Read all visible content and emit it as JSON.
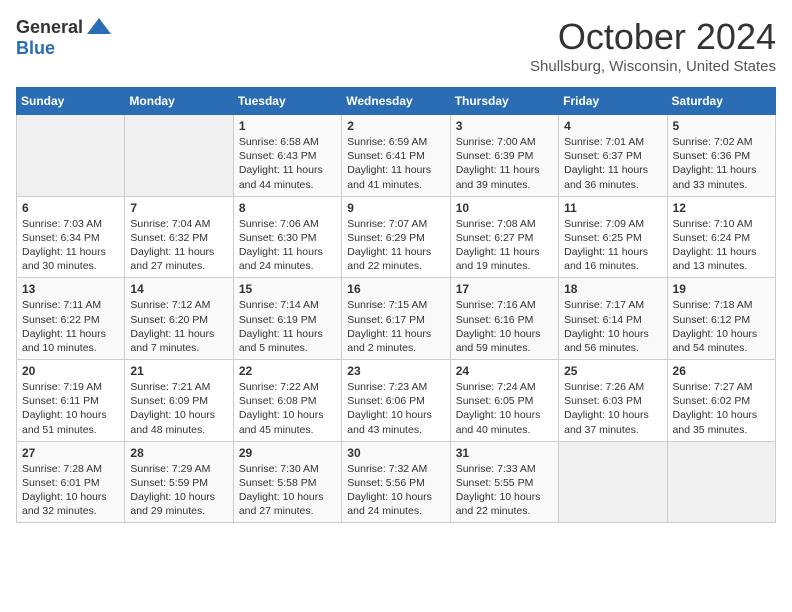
{
  "logo": {
    "general": "General",
    "blue": "Blue"
  },
  "title": {
    "month": "October 2024",
    "location": "Shullsburg, Wisconsin, United States"
  },
  "headers": [
    "Sunday",
    "Monday",
    "Tuesday",
    "Wednesday",
    "Thursday",
    "Friday",
    "Saturday"
  ],
  "weeks": [
    [
      null,
      null,
      {
        "day": "1",
        "sunrise": "Sunrise: 6:58 AM",
        "sunset": "Sunset: 6:43 PM",
        "daylight": "Daylight: 11 hours and 44 minutes."
      },
      {
        "day": "2",
        "sunrise": "Sunrise: 6:59 AM",
        "sunset": "Sunset: 6:41 PM",
        "daylight": "Daylight: 11 hours and 41 minutes."
      },
      {
        "day": "3",
        "sunrise": "Sunrise: 7:00 AM",
        "sunset": "Sunset: 6:39 PM",
        "daylight": "Daylight: 11 hours and 39 minutes."
      },
      {
        "day": "4",
        "sunrise": "Sunrise: 7:01 AM",
        "sunset": "Sunset: 6:37 PM",
        "daylight": "Daylight: 11 hours and 36 minutes."
      },
      {
        "day": "5",
        "sunrise": "Sunrise: 7:02 AM",
        "sunset": "Sunset: 6:36 PM",
        "daylight": "Daylight: 11 hours and 33 minutes."
      }
    ],
    [
      {
        "day": "6",
        "sunrise": "Sunrise: 7:03 AM",
        "sunset": "Sunset: 6:34 PM",
        "daylight": "Daylight: 11 hours and 30 minutes."
      },
      {
        "day": "7",
        "sunrise": "Sunrise: 7:04 AM",
        "sunset": "Sunset: 6:32 PM",
        "daylight": "Daylight: 11 hours and 27 minutes."
      },
      {
        "day": "8",
        "sunrise": "Sunrise: 7:06 AM",
        "sunset": "Sunset: 6:30 PM",
        "daylight": "Daylight: 11 hours and 24 minutes."
      },
      {
        "day": "9",
        "sunrise": "Sunrise: 7:07 AM",
        "sunset": "Sunset: 6:29 PM",
        "daylight": "Daylight: 11 hours and 22 minutes."
      },
      {
        "day": "10",
        "sunrise": "Sunrise: 7:08 AM",
        "sunset": "Sunset: 6:27 PM",
        "daylight": "Daylight: 11 hours and 19 minutes."
      },
      {
        "day": "11",
        "sunrise": "Sunrise: 7:09 AM",
        "sunset": "Sunset: 6:25 PM",
        "daylight": "Daylight: 11 hours and 16 minutes."
      },
      {
        "day": "12",
        "sunrise": "Sunrise: 7:10 AM",
        "sunset": "Sunset: 6:24 PM",
        "daylight": "Daylight: 11 hours and 13 minutes."
      }
    ],
    [
      {
        "day": "13",
        "sunrise": "Sunrise: 7:11 AM",
        "sunset": "Sunset: 6:22 PM",
        "daylight": "Daylight: 11 hours and 10 minutes."
      },
      {
        "day": "14",
        "sunrise": "Sunrise: 7:12 AM",
        "sunset": "Sunset: 6:20 PM",
        "daylight": "Daylight: 11 hours and 7 minutes."
      },
      {
        "day": "15",
        "sunrise": "Sunrise: 7:14 AM",
        "sunset": "Sunset: 6:19 PM",
        "daylight": "Daylight: 11 hours and 5 minutes."
      },
      {
        "day": "16",
        "sunrise": "Sunrise: 7:15 AM",
        "sunset": "Sunset: 6:17 PM",
        "daylight": "Daylight: 11 hours and 2 minutes."
      },
      {
        "day": "17",
        "sunrise": "Sunrise: 7:16 AM",
        "sunset": "Sunset: 6:16 PM",
        "daylight": "Daylight: 10 hours and 59 minutes."
      },
      {
        "day": "18",
        "sunrise": "Sunrise: 7:17 AM",
        "sunset": "Sunset: 6:14 PM",
        "daylight": "Daylight: 10 hours and 56 minutes."
      },
      {
        "day": "19",
        "sunrise": "Sunrise: 7:18 AM",
        "sunset": "Sunset: 6:12 PM",
        "daylight": "Daylight: 10 hours and 54 minutes."
      }
    ],
    [
      {
        "day": "20",
        "sunrise": "Sunrise: 7:19 AM",
        "sunset": "Sunset: 6:11 PM",
        "daylight": "Daylight: 10 hours and 51 minutes."
      },
      {
        "day": "21",
        "sunrise": "Sunrise: 7:21 AM",
        "sunset": "Sunset: 6:09 PM",
        "daylight": "Daylight: 10 hours and 48 minutes."
      },
      {
        "day": "22",
        "sunrise": "Sunrise: 7:22 AM",
        "sunset": "Sunset: 6:08 PM",
        "daylight": "Daylight: 10 hours and 45 minutes."
      },
      {
        "day": "23",
        "sunrise": "Sunrise: 7:23 AM",
        "sunset": "Sunset: 6:06 PM",
        "daylight": "Daylight: 10 hours and 43 minutes."
      },
      {
        "day": "24",
        "sunrise": "Sunrise: 7:24 AM",
        "sunset": "Sunset: 6:05 PM",
        "daylight": "Daylight: 10 hours and 40 minutes."
      },
      {
        "day": "25",
        "sunrise": "Sunrise: 7:26 AM",
        "sunset": "Sunset: 6:03 PM",
        "daylight": "Daylight: 10 hours and 37 minutes."
      },
      {
        "day": "26",
        "sunrise": "Sunrise: 7:27 AM",
        "sunset": "Sunset: 6:02 PM",
        "daylight": "Daylight: 10 hours and 35 minutes."
      }
    ],
    [
      {
        "day": "27",
        "sunrise": "Sunrise: 7:28 AM",
        "sunset": "Sunset: 6:01 PM",
        "daylight": "Daylight: 10 hours and 32 minutes."
      },
      {
        "day": "28",
        "sunrise": "Sunrise: 7:29 AM",
        "sunset": "Sunset: 5:59 PM",
        "daylight": "Daylight: 10 hours and 29 minutes."
      },
      {
        "day": "29",
        "sunrise": "Sunrise: 7:30 AM",
        "sunset": "Sunset: 5:58 PM",
        "daylight": "Daylight: 10 hours and 27 minutes."
      },
      {
        "day": "30",
        "sunrise": "Sunrise: 7:32 AM",
        "sunset": "Sunset: 5:56 PM",
        "daylight": "Daylight: 10 hours and 24 minutes."
      },
      {
        "day": "31",
        "sunrise": "Sunrise: 7:33 AM",
        "sunset": "Sunset: 5:55 PM",
        "daylight": "Daylight: 10 hours and 22 minutes."
      },
      null,
      null
    ]
  ]
}
